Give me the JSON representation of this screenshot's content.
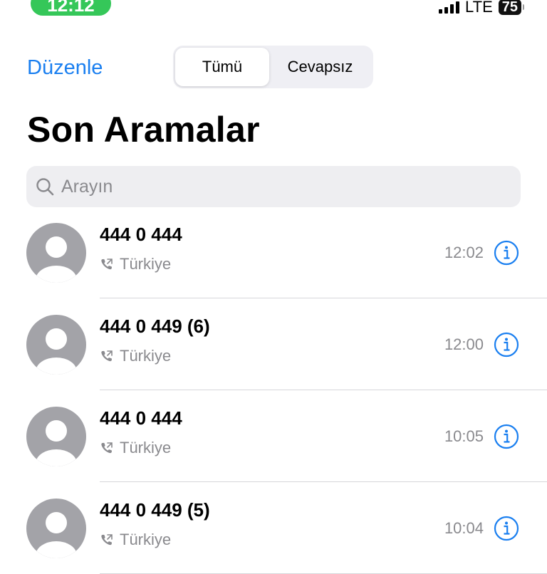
{
  "status_bar": {
    "time": "12:12",
    "network": "LTE",
    "battery": "75"
  },
  "header": {
    "edit_label": "Düzenle",
    "tabs": [
      {
        "label": "Tümü",
        "selected": true
      },
      {
        "label": "Cevapsız",
        "selected": false
      }
    ],
    "title": "Son Aramalar"
  },
  "search": {
    "placeholder": "Arayın",
    "value": ""
  },
  "calls": [
    {
      "name": "444 0 444",
      "location": "Türkiye",
      "time": "12:02"
    },
    {
      "name": "444 0 449 (6)",
      "location": "Türkiye",
      "time": "12:00"
    },
    {
      "name": "444 0 444",
      "location": "Türkiye",
      "time": "10:05"
    },
    {
      "name": "444 0 449 (5)",
      "location": "Türkiye",
      "time": "10:04"
    }
  ],
  "colors": {
    "accent": "#1a7ff0",
    "status_pill": "#35c759",
    "secondary_text": "#8a8a8e"
  },
  "icons": {
    "search": "magnifying-glass-icon",
    "avatar": "person-silhouette-icon",
    "call_type": "phone-outgoing-icon",
    "info": "info-circle-icon"
  }
}
